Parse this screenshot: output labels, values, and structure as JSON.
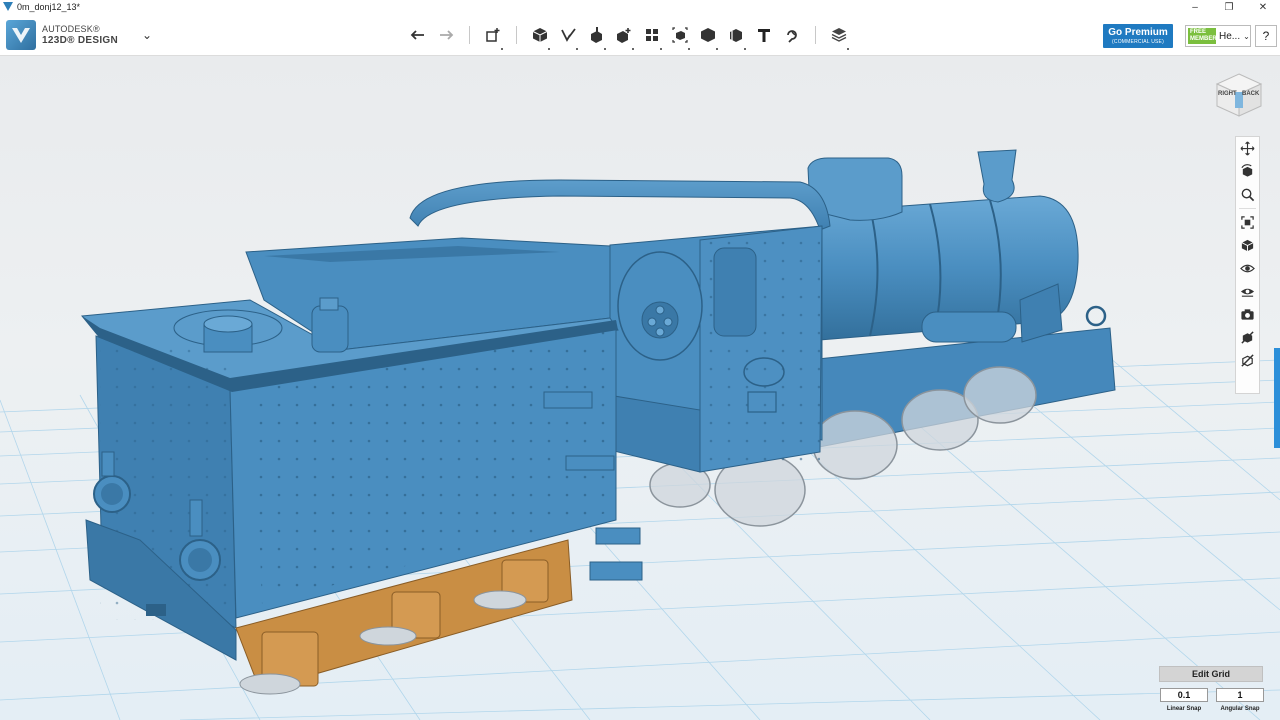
{
  "window": {
    "title": "0m_donj12_13*",
    "minimize": "–",
    "restore": "❐",
    "close": "✕"
  },
  "app": {
    "brand_line1": "AUTODESK®",
    "brand_line2": "123D® DESIGN"
  },
  "toolbar": {
    "tools": [
      {
        "name": "undo",
        "icon": "undo-arrow-icon"
      },
      {
        "name": "redo",
        "icon": "redo-arrow-icon"
      },
      {
        "name": "transform",
        "icon": "transform-icon"
      },
      {
        "name": "primitives",
        "icon": "primitive-box-icon"
      },
      {
        "name": "sketch",
        "icon": "sketch-pencil-icon"
      },
      {
        "name": "construct",
        "icon": "construct-icon"
      },
      {
        "name": "modify",
        "icon": "modify-icon"
      },
      {
        "name": "pattern",
        "icon": "pattern-icon"
      },
      {
        "name": "group",
        "icon": "group-icon"
      },
      {
        "name": "combine",
        "icon": "combine-icon"
      },
      {
        "name": "measure",
        "icon": "measure-icon"
      },
      {
        "name": "text",
        "icon": "text-T-icon"
      },
      {
        "name": "snap",
        "icon": "snap-icon"
      },
      {
        "name": "materials",
        "icon": "materials-layers-icon"
      }
    ],
    "text_tool_glyph": "T"
  },
  "premium": {
    "label": "Go Premium",
    "sub": "(COMMERCIAL USE)"
  },
  "account": {
    "badge_line1": "FREE",
    "badge_line2": "MEMBER",
    "name": "He..."
  },
  "help_label": "?",
  "viewcube": {
    "right_face": "RIGHT",
    "back_face": "BACK"
  },
  "navbar": [
    "pan-icon",
    "orbit-icon",
    "zoom-icon",
    "fit-icon",
    "view-box-icon",
    "eye-icon",
    "visibility-icon",
    "camera-icon",
    "snapshot-off-icon",
    "material-off-icon"
  ],
  "edit_grid": {
    "label": "Edit Grid",
    "linear_value": "0.1",
    "linear_label": "Linear Snap",
    "angular_value": "1",
    "angular_label": "Angular Snap"
  },
  "colors": {
    "model_blue": "#4a8ec0",
    "model_dark": "#2c6188",
    "bronze": "#c98e44",
    "grid_line": "#a9d2ea",
    "accent": "#1f7ac1"
  }
}
